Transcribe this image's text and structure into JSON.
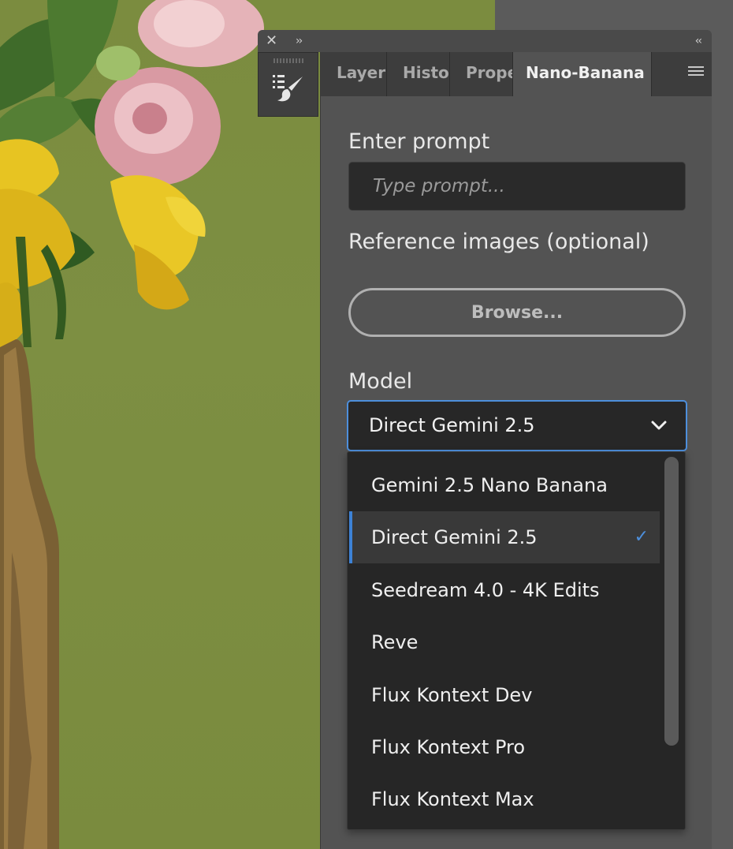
{
  "titlebar": {
    "close_glyph": "✕",
    "expand_glyph": "››",
    "collapse_glyph": "‹‹"
  },
  "tabs": [
    {
      "label": "Layers"
    },
    {
      "label": "History"
    },
    {
      "label": "Properties"
    },
    {
      "label": "Nano-Banana"
    }
  ],
  "prompt": {
    "label": "Enter prompt",
    "placeholder": "Type prompt..."
  },
  "reference": {
    "label": "Reference images (optional)",
    "browse_label": "Browse..."
  },
  "model": {
    "label": "Model",
    "selected": "Direct Gemini 2.5",
    "options": [
      {
        "label": "Gemini 2.5 Nano Banana"
      },
      {
        "label": "Direct Gemini 2.5",
        "checkmark": "✓"
      },
      {
        "label": "Seedream 4.0 - 4K Edits"
      },
      {
        "label": "Reve"
      },
      {
        "label": "Flux Kontext Dev"
      },
      {
        "label": "Flux Kontext Pro"
      },
      {
        "label": "Flux Kontext Max"
      }
    ]
  },
  "colors": {
    "accent": "#4d8fdc",
    "panel_bg": "#535353",
    "canvas_green": "#7b8c3f"
  },
  "icons": [
    "close-icon",
    "expand-icon",
    "collapse-icon",
    "brush-panel-icon",
    "panel-menu-icon",
    "chevron-down-icon",
    "check-icon"
  ]
}
